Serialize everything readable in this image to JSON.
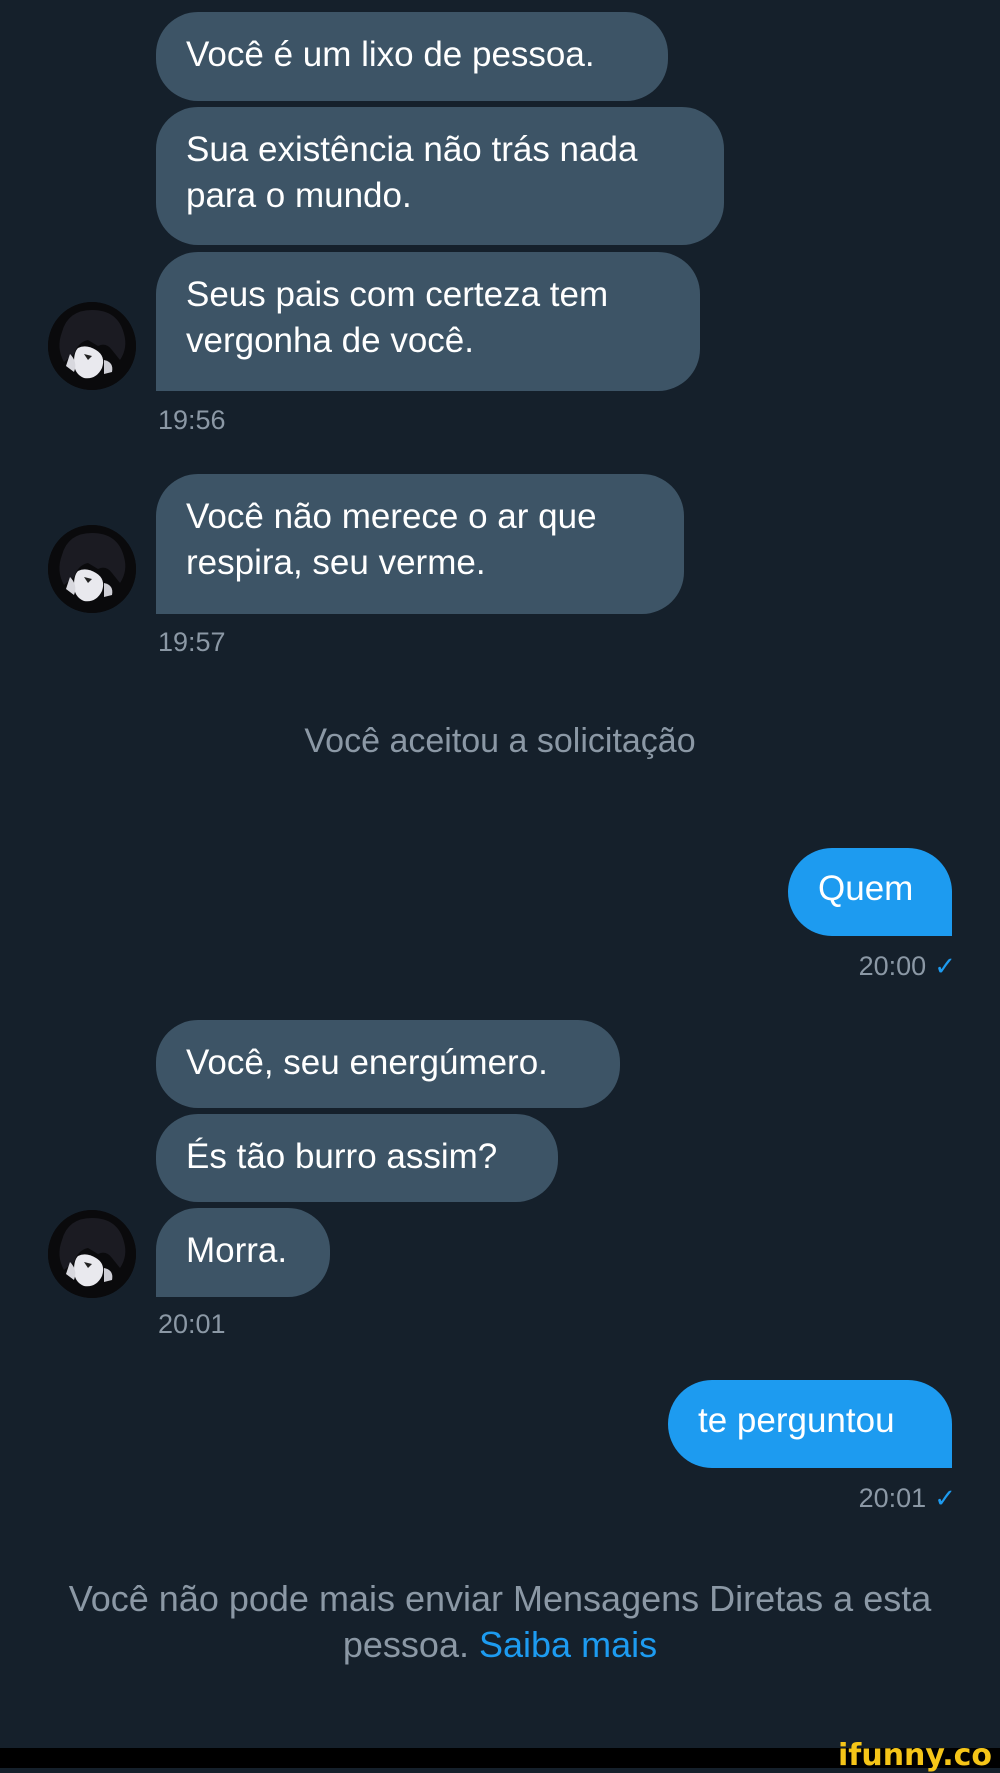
{
  "conversation": {
    "group1": {
      "messages": [
        "Você é um lixo de pessoa.",
        "Sua existência não trás nada para o mundo.",
        "Seus pais com certeza tem vergonha de você."
      ],
      "time": "19:56"
    },
    "group2": {
      "messages": [
        "Você não merece o ar que respira, seu verme."
      ],
      "time": "19:57"
    },
    "system_notice": "Você aceitou a solicitação",
    "sent1": {
      "text": "Quem",
      "time": "20:00",
      "status": "✓"
    },
    "group3": {
      "messages": [
        "Você, seu energúmero.",
        "És tão burro assim?",
        "Morra."
      ],
      "time": "20:01"
    },
    "sent2": {
      "text": "te perguntou",
      "time": "20:01",
      "status": "✓"
    }
  },
  "footer": {
    "text": "Você não pode mais enviar Mensagens Diretas a esta pessoa.",
    "link": "Saiba mais"
  },
  "watermark": "ifunny.co",
  "colors": {
    "background": "#15202b",
    "received_bubble": "#3d5466",
    "sent_bubble": "#1d9bf0",
    "muted_text": "#8b98a5",
    "link": "#1d9bf0"
  },
  "icons": {
    "avatar": "anime-avatar",
    "read_receipt": "check-icon"
  }
}
